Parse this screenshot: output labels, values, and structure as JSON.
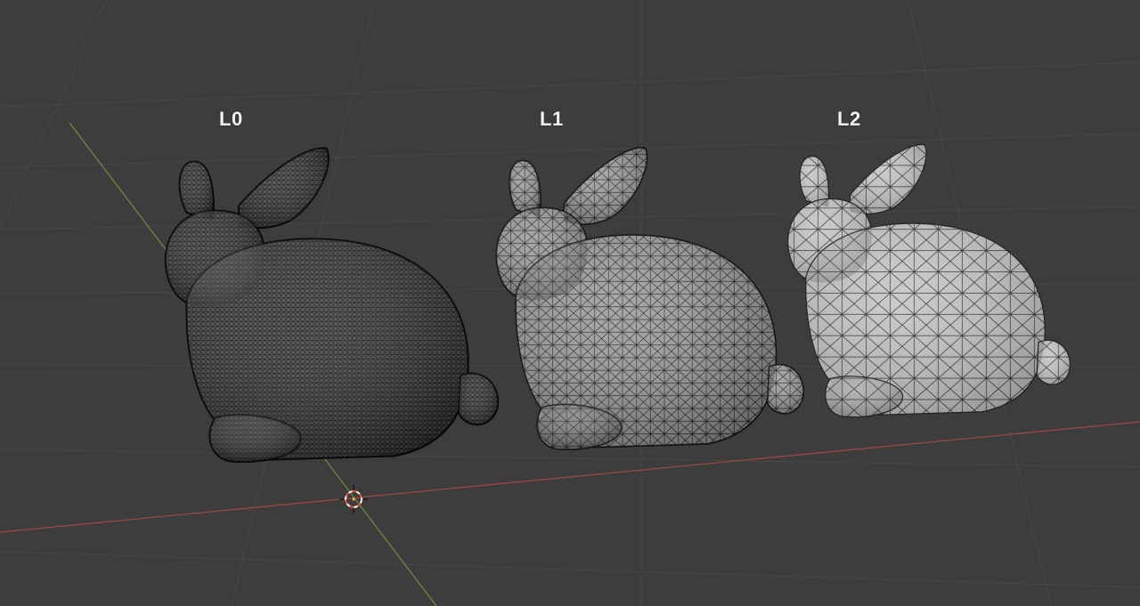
{
  "viewport": {
    "background": "#3d3d3d",
    "grid_color": "#474747",
    "x_axis_color": "#a04848",
    "y_axis_color": "#6e8e3a",
    "cursor_icon": "3d-cursor-icon"
  },
  "lod_levels": [
    {
      "label": "L0",
      "shade": "#4a4a4a",
      "wire": "#0e0e0e",
      "wire_density": "dense"
    },
    {
      "label": "L1",
      "shade": "#9a9a9a",
      "wire": "#1c1c1c",
      "wire_density": "medium"
    },
    {
      "label": "L2",
      "shade": "#c4c4c4",
      "wire": "#2a2a2a",
      "wire_density": "coarse"
    }
  ]
}
